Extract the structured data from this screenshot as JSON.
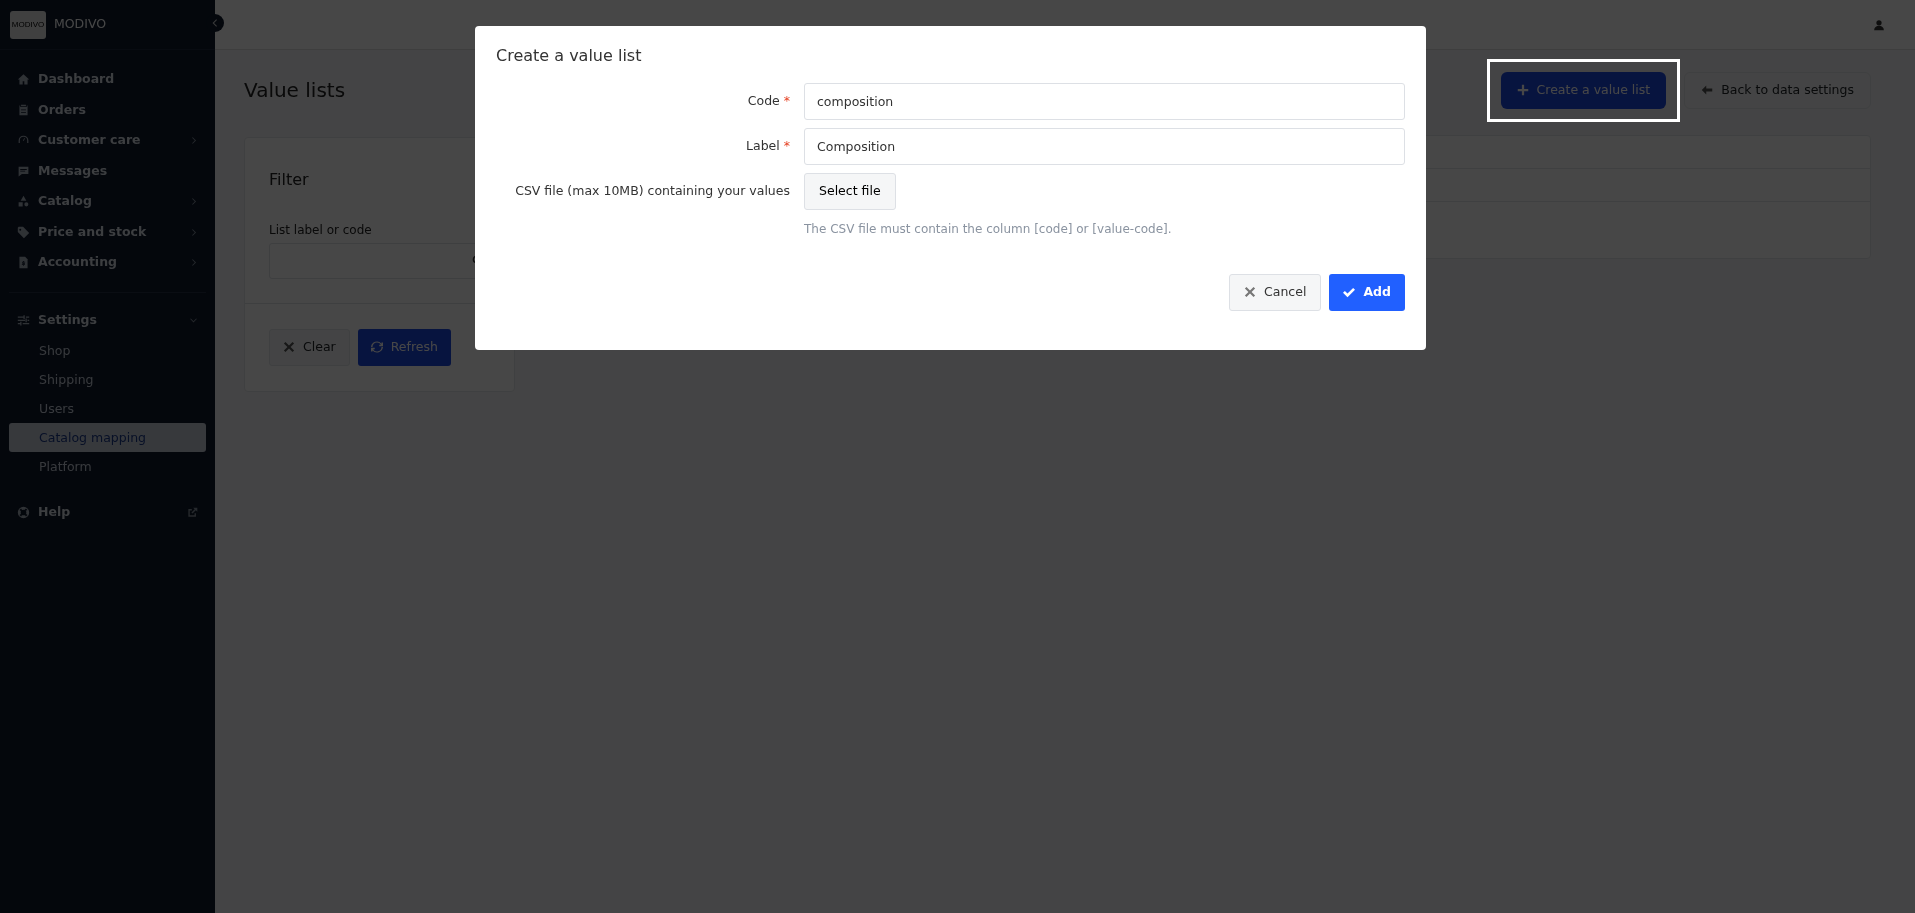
{
  "sidebar": {
    "logo_text": "MODIVO",
    "brand": "MODIVO",
    "items": [
      {
        "label": "Dashboard",
        "submenu": false
      },
      {
        "label": "Orders",
        "submenu": false
      },
      {
        "label": "Customer care",
        "submenu": true
      },
      {
        "label": "Messages",
        "submenu": false
      },
      {
        "label": "Catalog",
        "submenu": true
      },
      {
        "label": "Price and stock",
        "submenu": true
      },
      {
        "label": "Accounting",
        "submenu": true
      }
    ],
    "settings": {
      "label": "Settings",
      "expanded": true,
      "children": [
        {
          "label": "Shop",
          "selected": false
        },
        {
          "label": "Shipping",
          "selected": false
        },
        {
          "label": "Users",
          "selected": false
        },
        {
          "label": "Catalog mapping",
          "selected": true
        },
        {
          "label": "Platform",
          "selected": false
        }
      ]
    },
    "help": {
      "label": "Help"
    }
  },
  "page": {
    "title": "Value lists",
    "buttons": [
      {
        "label": "Create a value list",
        "kind": "primary",
        "highlighted": true
      },
      {
        "label": "Back to data settings",
        "kind": "back"
      }
    ],
    "filter": {
      "title": "Filter",
      "field_label": "List label or code",
      "buttons": [
        {
          "label": "Clear",
          "kind": "clear"
        },
        {
          "label": "Refresh",
          "kind": "refresh"
        }
      ]
    }
  },
  "modal": {
    "title": "Create a value list",
    "fields": [
      {
        "kind": "text",
        "label": "Code",
        "required_mark": "*",
        "value": "composition"
      },
      {
        "kind": "text",
        "label": "Label",
        "required_mark": "*",
        "value": "Composition"
      },
      {
        "kind": "file",
        "label": "CSV file (max 10MB) containing your values",
        "button": "Select file",
        "help": "The CSV file must contain the column [code] or [value-code]."
      }
    ],
    "buttons": [
      {
        "label": "Cancel",
        "kind": "cancel"
      },
      {
        "label": "Add",
        "kind": "add"
      }
    ]
  }
}
